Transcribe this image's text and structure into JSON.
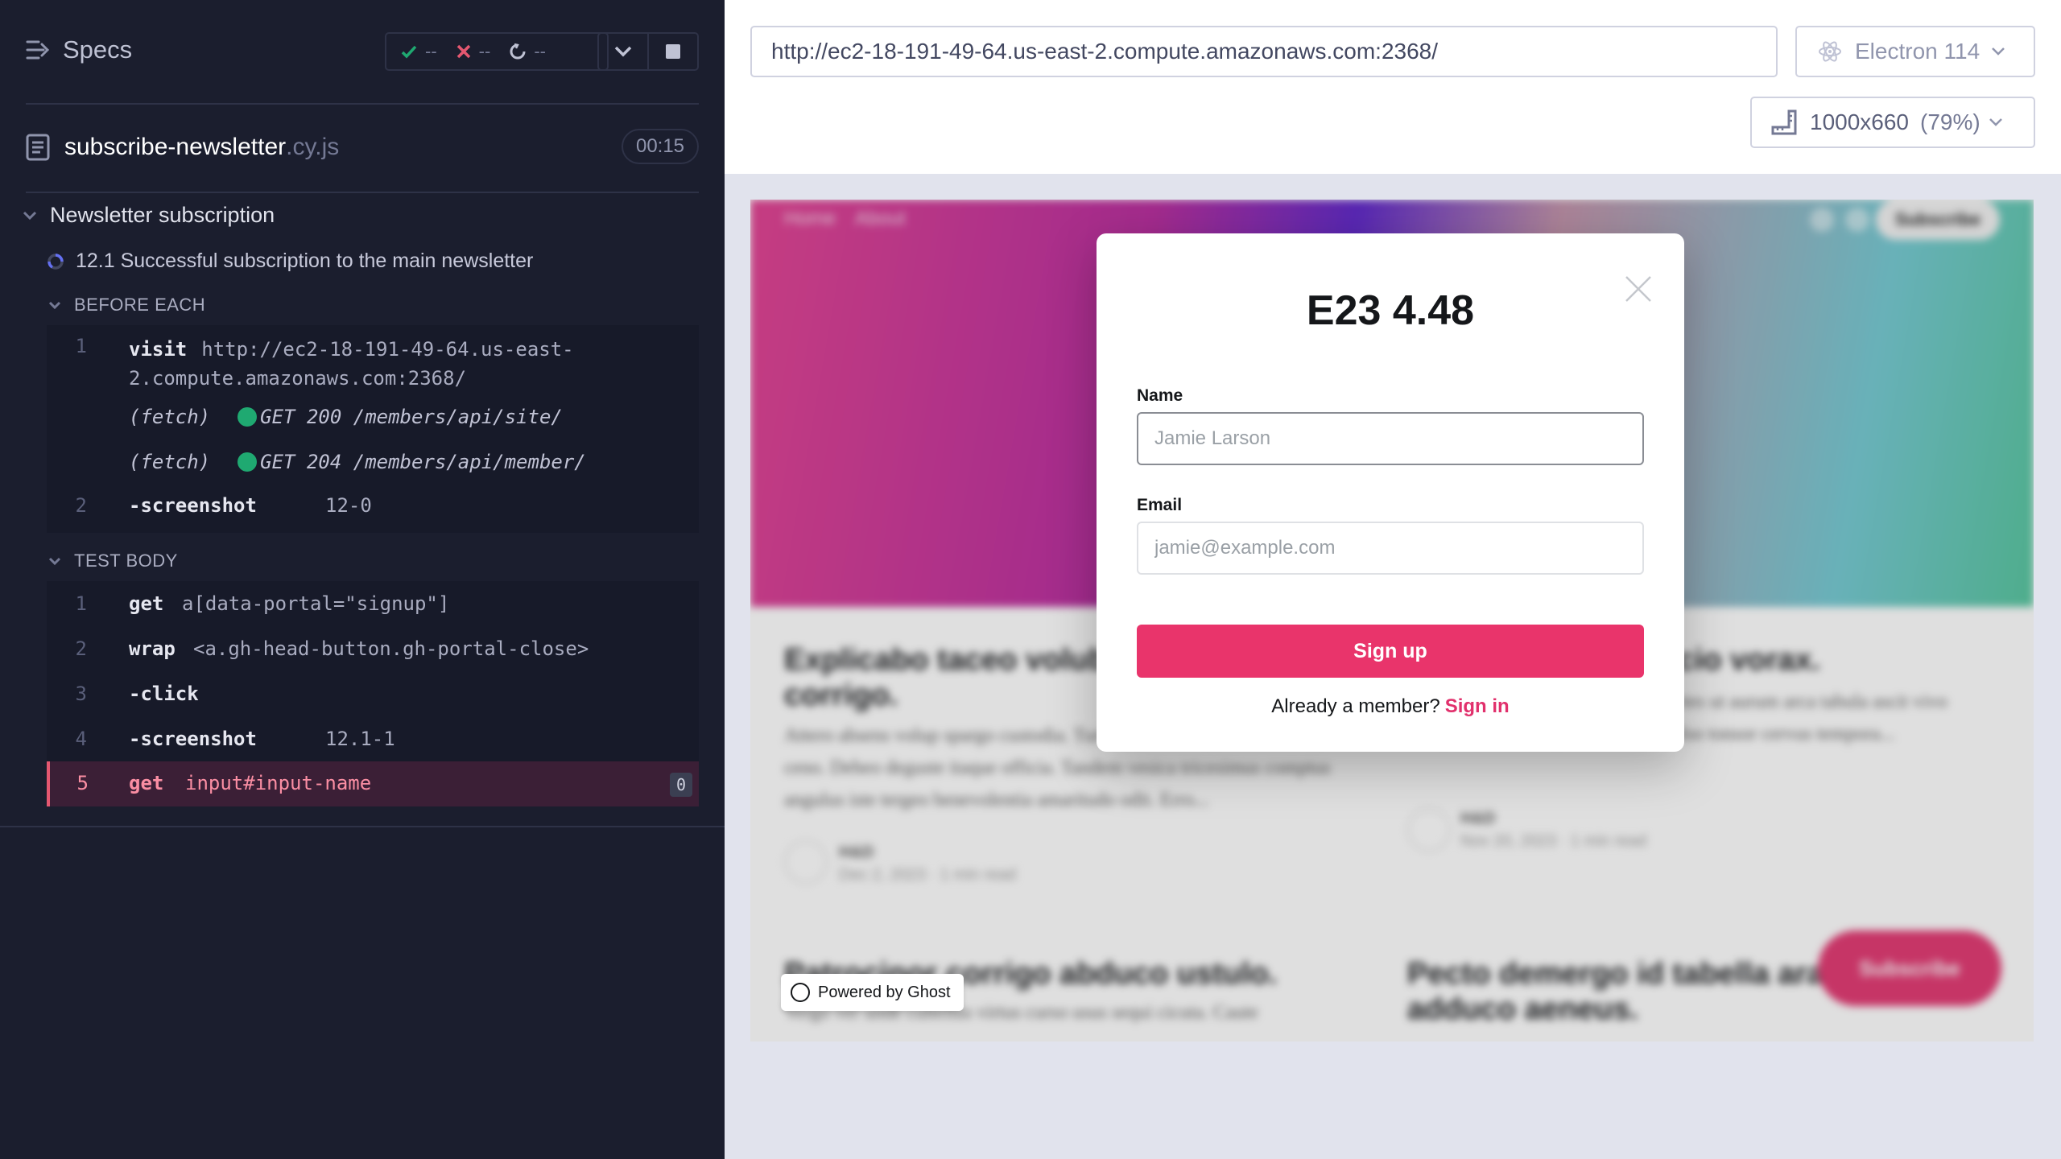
{
  "reporter": {
    "header": {
      "title": "Specs",
      "passed": "--",
      "failed": "--",
      "pending": "--"
    },
    "file": {
      "name": "subscribe-newsletter",
      "ext": ".cy.js",
      "duration": "00:15"
    },
    "suite": "Newsletter subscription",
    "test": "12.1 Successful subscription to the main newsletter",
    "before_each": {
      "label": "BEFORE EACH",
      "visit_num": "1",
      "visit_name": "visit",
      "visit_url": "http://ec2-18-191-49-64.us-east-2.compute.amazonaws.com:2368/",
      "xhr1_prefix": "(fetch)",
      "xhr1_text": "GET 200 /members/api/site/",
      "xhr2_prefix": "(fetch)",
      "xhr2_text": "GET 204 /members/api/member/",
      "shot_num": "2",
      "shot_name": "-screenshot",
      "shot_msg": "12-0"
    },
    "test_body": {
      "label": "TEST BODY",
      "commands": [
        {
          "num": "1",
          "name": "get",
          "msg": "a[data-portal=\"signup\"]"
        },
        {
          "num": "2",
          "name": "wrap",
          "msg": "<a.gh-head-button.gh-portal-close>"
        },
        {
          "num": "3",
          "name": "-click",
          "msg": ""
        },
        {
          "num": "4",
          "name": "-screenshot",
          "msg": "12.1-1"
        },
        {
          "num": "5",
          "name": "get",
          "msg": "input#input-name",
          "badge": "0"
        }
      ]
    }
  },
  "aut": {
    "url": "http://ec2-18-191-49-64.us-east-2.compute.amazonaws.com:2368/",
    "browser": "Electron 114",
    "viewport": "1000x660",
    "scale": "(79%)",
    "site": {
      "nav": [
        "Home",
        "About"
      ],
      "subscribe": "Subscribe",
      "posts": [
        {
          "title": "Explicabo taceo volubi derelinquo corrigo.",
          "excerpt": "Attero absens volup spargo custodia. Turbo tandem tergum dolor eligendi ceno. Debeo deguste itaque officia. Tandem vesica tricesimus comptus angulus iste tergeo benevolentia amaritudo odit. Erro...",
          "author": "H&D",
          "meta": "Dec 2, 2023 · 1 min read"
        },
        {
          "title": "deficio vorax.",
          "excerpt": "Volo tempore abutor carmen. Cometes ut aurum arca tabula ascit vivo comparo corona dignissimos. Depulso tonsor cervus tempora...",
          "author": "H&D",
          "meta": "Nov 20, 2023 · 1 min read"
        },
        {
          "title": "Patrocinor corrigo abduco ustulo.",
          "excerpt": "Vergo ver unde cultellus virtus curso usus sequi cicuta. Caute",
          "author": "",
          "meta": ""
        },
        {
          "title": "Pecto demergo id tabella ara adduco aeneus.",
          "excerpt": "",
          "author": "",
          "meta": ""
        }
      ],
      "float_subscribe": "Subscribe",
      "powered": "Powered by Ghost"
    },
    "modal": {
      "title": "E23 4.48",
      "name_label": "Name",
      "name_placeholder": "Jamie Larson",
      "email_label": "Email",
      "email_placeholder": "jamie@example.com",
      "signup": "Sign up",
      "member_text": "Already a member?",
      "signin": "Sign in"
    }
  }
}
